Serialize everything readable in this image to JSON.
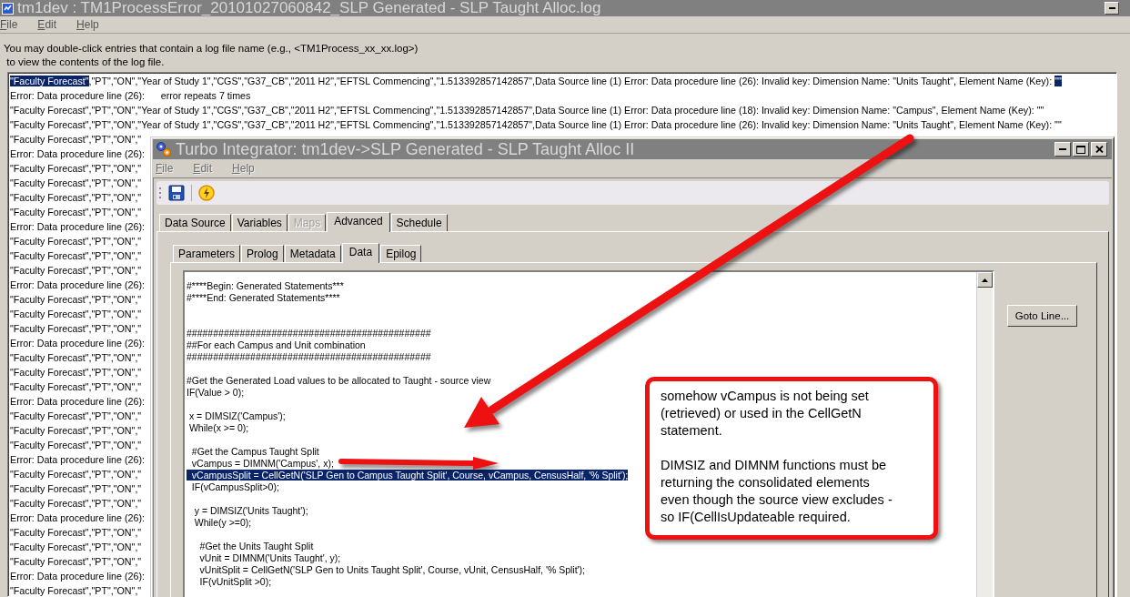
{
  "log_window": {
    "title": "tm1dev : TM1ProcessError_20101027060842_SLP Generated - SLP Taught Alloc.log",
    "menu": [
      {
        "label": "File",
        "disabled": false
      },
      {
        "label": "Edit",
        "disabled": false
      },
      {
        "label": "Help",
        "disabled": false
      }
    ],
    "hint_lines": [
      "You may double-click entries that contain a log file name (e.g., <TM1Process_xx_xx.log>)",
      " to view the contents of the log file."
    ],
    "entries": [
      {
        "parts": [
          {
            "text": "\"Faculty Forecast\"",
            "highlighted": true
          },
          {
            "text": ",\"PT\",\"ON\",\"Year of Study 1\",\"CGS\",\"G37_CB\",\"2011 H2\",\"EFTSL Commencing\",\"1.513392857142857\",Data Source line (1) Error: Data procedure line (26): Invalid key: Dimension Name: \"Units Taught\", Element Name (Key): ",
            "highlighted": false
          },
          {
            "text": "\"\"",
            "highlighted": true
          }
        ]
      },
      {
        "parts": [
          {
            "text": "Error: Data procedure line (26):      error repeats 7 times",
            "highlighted": false
          }
        ]
      },
      {
        "parts": [
          {
            "text": "\"Faculty Forecast\",\"PT\",\"ON\",\"Year of Study 1\",\"CGS\",\"G37_CB\",\"2011 H2\",\"EFTSL Commencing\",\"1.513392857142857\",Data Source line (1) Error: Data procedure line (18): Invalid key: Dimension Name: \"Campus\", Element Name (Key): \"\"",
            "highlighted": false
          }
        ]
      },
      {
        "parts": [
          {
            "text": "\"Faculty Forecast\",\"PT\",\"ON\",\"Year of Study 1\",\"CGS\",\"G37_CB\",\"2011 H2\",\"EFTSL Commencing\",\"1.513392857142857\",Data Source line (1) Error: Data procedure line (26): Invalid key: Dimension Name: \"Units Taught\", Element Name (Key): \"\"",
            "highlighted": false
          }
        ]
      },
      {
        "parts": [
          {
            "text": "\"Faculty Forecast\",\"PT\",\"ON\",\"",
            "highlighted": false
          }
        ]
      },
      {
        "parts": [
          {
            "text": "Error: Data procedure line (26):",
            "highlighted": false
          }
        ]
      },
      {
        "parts": [
          {
            "text": "\"Faculty Forecast\",\"PT\",\"ON\",\"",
            "highlighted": false
          }
        ]
      },
      {
        "parts": [
          {
            "text": "\"Faculty Forecast\",\"PT\",\"ON\",\"",
            "highlighted": false
          }
        ]
      },
      {
        "parts": [
          {
            "text": "\"Faculty Forecast\",\"PT\",\"ON\",\"",
            "highlighted": false
          }
        ]
      },
      {
        "parts": [
          {
            "text": "\"Faculty Forecast\",\"PT\",\"ON\",\"",
            "highlighted": false
          }
        ]
      },
      {
        "parts": [
          {
            "text": "Error: Data procedure line (26):",
            "highlighted": false
          }
        ]
      },
      {
        "parts": [
          {
            "text": "\"Faculty Forecast\",\"PT\",\"ON\",\"",
            "highlighted": false
          }
        ]
      },
      {
        "parts": [
          {
            "text": "\"Faculty Forecast\",\"PT\",\"ON\",\"",
            "highlighted": false
          }
        ]
      },
      {
        "parts": [
          {
            "text": "\"Faculty Forecast\",\"PT\",\"ON\",\"",
            "highlighted": false
          }
        ]
      },
      {
        "parts": [
          {
            "text": "Error: Data procedure line (26):",
            "highlighted": false
          }
        ]
      },
      {
        "parts": [
          {
            "text": "\"Faculty Forecast\",\"PT\",\"ON\",\"",
            "highlighted": false
          }
        ]
      },
      {
        "parts": [
          {
            "text": "\"Faculty Forecast\",\"PT\",\"ON\",\"",
            "highlighted": false
          }
        ]
      },
      {
        "parts": [
          {
            "text": "\"Faculty Forecast\",\"PT\",\"ON\",\"",
            "highlighted": false
          }
        ]
      },
      {
        "parts": [
          {
            "text": "Error: Data procedure line (26):",
            "highlighted": false
          }
        ]
      },
      {
        "parts": [
          {
            "text": "\"Faculty Forecast\",\"PT\",\"ON\",\"",
            "highlighted": false
          }
        ]
      },
      {
        "parts": [
          {
            "text": "\"Faculty Forecast\",\"PT\",\"ON\",\"",
            "highlighted": false
          }
        ]
      },
      {
        "parts": [
          {
            "text": "\"Faculty Forecast\",\"PT\",\"ON\",\"",
            "highlighted": false
          }
        ]
      },
      {
        "parts": [
          {
            "text": "Error: Data procedure line (26):",
            "highlighted": false
          }
        ]
      },
      {
        "parts": [
          {
            "text": "\"Faculty Forecast\",\"PT\",\"ON\",\"",
            "highlighted": false
          }
        ]
      },
      {
        "parts": [
          {
            "text": "\"Faculty Forecast\",\"PT\",\"ON\",\"",
            "highlighted": false
          }
        ]
      },
      {
        "parts": [
          {
            "text": "\"Faculty Forecast\",\"PT\",\"ON\",\"",
            "highlighted": false
          }
        ]
      },
      {
        "parts": [
          {
            "text": "Error: Data procedure line (26):",
            "highlighted": false
          }
        ]
      },
      {
        "parts": [
          {
            "text": "\"Faculty Forecast\",\"PT\",\"ON\",\"",
            "highlighted": false
          }
        ]
      },
      {
        "parts": [
          {
            "text": "\"Faculty Forecast\",\"PT\",\"ON\",\"",
            "highlighted": false
          }
        ]
      },
      {
        "parts": [
          {
            "text": "\"Faculty Forecast\",\"PT\",\"ON\",\"",
            "highlighted": false
          }
        ]
      },
      {
        "parts": [
          {
            "text": "Error: Data procedure line (26):",
            "highlighted": false
          }
        ]
      },
      {
        "parts": [
          {
            "text": "\"Faculty Forecast\",\"PT\",\"ON\",\"",
            "highlighted": false
          }
        ]
      },
      {
        "parts": [
          {
            "text": "\"Faculty Forecast\",\"PT\",\"ON\",\"",
            "highlighted": false
          }
        ]
      },
      {
        "parts": [
          {
            "text": "\"Faculty Forecast\",\"PT\",\"ON\",\"",
            "highlighted": false
          }
        ]
      },
      {
        "parts": [
          {
            "text": "Error: Data procedure line (26):",
            "highlighted": false
          }
        ]
      },
      {
        "parts": [
          {
            "text": "\"Faculty Forecast\",\"PT\",\"ON\",\"",
            "highlighted": false
          }
        ]
      }
    ]
  },
  "ti_window": {
    "title": "Turbo Integrator:  tm1dev->SLP Generated - SLP Taught Alloc II",
    "menu": [
      {
        "label": "File",
        "disabled": true
      },
      {
        "label": "Edit",
        "disabled": true
      },
      {
        "label": "Help",
        "disabled": true
      }
    ],
    "tabs": [
      {
        "label": "Data Source",
        "selected": false,
        "disabled": false
      },
      {
        "label": "Variables",
        "selected": false,
        "disabled": false
      },
      {
        "label": "Maps",
        "selected": false,
        "disabled": true
      },
      {
        "label": "Advanced",
        "selected": true,
        "disabled": false
      },
      {
        "label": "Schedule",
        "selected": false,
        "disabled": false
      }
    ],
    "subtabs": [
      {
        "label": "Parameters",
        "selected": false
      },
      {
        "label": "Prolog",
        "selected": false
      },
      {
        "label": "Metadata",
        "selected": false
      },
      {
        "label": "Data",
        "selected": true
      },
      {
        "label": "Epilog",
        "selected": false
      }
    ],
    "code_lines": [
      {
        "kind": "code",
        "text": "#****Begin: Generated Statements***",
        "selected": false
      },
      {
        "kind": "code",
        "text": "#****End: Generated Statements****",
        "selected": false
      },
      {
        "kind": "blank"
      },
      {
        "kind": "blank"
      },
      {
        "kind": "code",
        "text": "##############################################",
        "selected": false
      },
      {
        "kind": "code",
        "text": "##For each Campus and Unit combination",
        "selected": false
      },
      {
        "kind": "code",
        "text": "##############################################",
        "selected": false
      },
      {
        "kind": "blank"
      },
      {
        "kind": "code",
        "text": "#Get the Generated Load values to be allocated to Taught - source view",
        "selected": false
      },
      {
        "kind": "code",
        "text": "IF(Value > 0);",
        "selected": false
      },
      {
        "kind": "blank"
      },
      {
        "kind": "code",
        "text": " x = DIMSIZ('Campus');",
        "selected": false
      },
      {
        "kind": "code",
        "text": " While(x >= 0);",
        "selected": false
      },
      {
        "kind": "blank"
      },
      {
        "kind": "code",
        "text": "  #Get the Campus Taught Split",
        "selected": false
      },
      {
        "kind": "code",
        "text": "  vCampus = DIMNM('Campus', x);",
        "selected": false
      },
      {
        "kind": "code",
        "text": "  vCampusSplit = CellGetN('SLP Gen to Campus Taught Split', Course, vCampus, CensusHalf, '% Split');",
        "selected": true
      },
      {
        "kind": "code",
        "text": "  IF(vCampusSplit>0);",
        "selected": false
      },
      {
        "kind": "blank"
      },
      {
        "kind": "code",
        "text": "   y = DIMSIZ('Units Taught');",
        "selected": false
      },
      {
        "kind": "code",
        "text": "   While(y >=0);",
        "selected": false
      },
      {
        "kind": "blank"
      },
      {
        "kind": "code",
        "text": "     #Get the Units Taught Split",
        "selected": false
      },
      {
        "kind": "code",
        "text": "     vUnit = DIMNM('Units Taught', y);",
        "selected": false
      },
      {
        "kind": "code",
        "text": "     vUnitSplit = CellGetN('SLP Gen to Units Taught Split', Course, vUnit, CensusHalf, '% Split');",
        "selected": false
      },
      {
        "kind": "code",
        "text": "     IF(vUnitSplit >0);",
        "selected": false
      }
    ],
    "goto_button": "Goto Line..."
  },
  "callout": {
    "paragraphs": [
      "somehow vCampus is not being set (retrieved) or used in the CellGetN statement.",
      "DIMSIZ and DIMNM functions must be returning the consolidated elements even though the source view excludes - so IF(CellIsUpdateable required."
    ]
  }
}
